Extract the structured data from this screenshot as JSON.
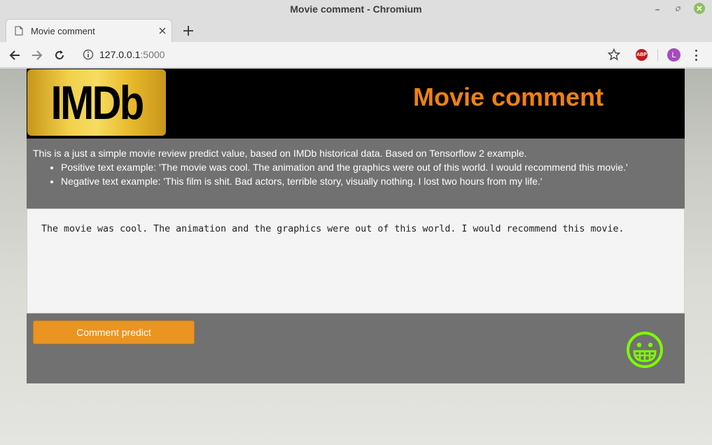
{
  "window": {
    "title": "Movie comment - Chromium"
  },
  "tab": {
    "label": "Movie comment"
  },
  "address": {
    "host": "127.0.0.1",
    "port": ":5000"
  },
  "extensions": {
    "abp": "ABP",
    "avatar": "L"
  },
  "header": {
    "logo": "IMDb",
    "title": "Movie comment"
  },
  "info": {
    "description": "This is a just a simple movie review predict value, based on IMDb historical data. Based on Tensorflow 2 example.",
    "examples": [
      "Positive text example: 'The movie was cool. The animation and the graphics were out of this world. I would recommend this movie.'",
      "Negative text example: 'This film is shit. Bad actors, terrible story, visually nothing. I lost two hours from my life.'"
    ]
  },
  "comment": {
    "value": "The movie was cool. The animation and the graphics were out of this world. I would recommend this movie."
  },
  "actions": {
    "predict_label": "Comment predict",
    "result_icon": "grinning-face-icon",
    "result_color": "#7cfc00"
  },
  "colors": {
    "accent": "#f0820f",
    "button": "#ea9421",
    "panel": "#717171"
  }
}
